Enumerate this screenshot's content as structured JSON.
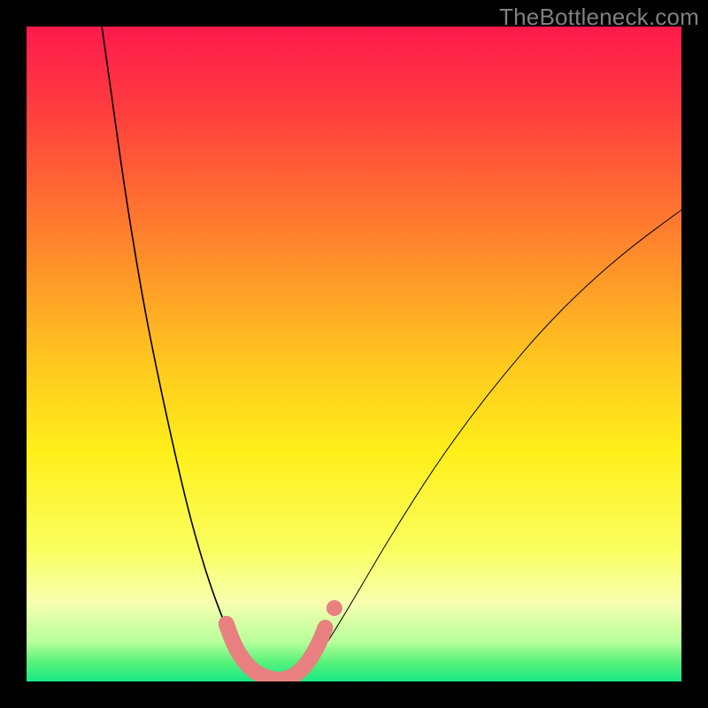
{
  "watermark": "TheBottleneck.com",
  "chart_data": {
    "type": "line",
    "title": "",
    "xlabel": "",
    "ylabel": "",
    "xlim": [
      0,
      100
    ],
    "ylim": [
      0,
      100
    ],
    "background_gradient_stops": [
      {
        "offset": 0.0,
        "color": "#ff1a4d"
      },
      {
        "offset": 0.12,
        "color": "#ff3b3f"
      },
      {
        "offset": 0.3,
        "color": "#ff7a2f"
      },
      {
        "offset": 0.5,
        "color": "#ffc31f"
      },
      {
        "offset": 0.65,
        "color": "#ffef1a"
      },
      {
        "offset": 0.8,
        "color": "#faff60"
      },
      {
        "offset": 0.88,
        "color": "#f7ffb0"
      },
      {
        "offset": 0.94,
        "color": "#b6ff9a"
      },
      {
        "offset": 0.97,
        "color": "#58f27a"
      },
      {
        "offset": 1.0,
        "color": "#19e884"
      }
    ],
    "series": [
      {
        "name": "left-curve",
        "type": "path",
        "stroke": "#000000",
        "stroke_width": 1.6,
        "points": [
          {
            "x": 11.5,
            "y": 100
          },
          {
            "x": 12.2,
            "y": 95
          },
          {
            "x": 13.2,
            "y": 88
          },
          {
            "x": 14.3,
            "y": 80
          },
          {
            "x": 15.5,
            "y": 72
          },
          {
            "x": 16.8,
            "y": 64
          },
          {
            "x": 18.2,
            "y": 56
          },
          {
            "x": 19.8,
            "y": 48
          },
          {
            "x": 21.5,
            "y": 40
          },
          {
            "x": 23.3,
            "y": 32
          },
          {
            "x": 25.0,
            "y": 25
          },
          {
            "x": 26.7,
            "y": 19
          },
          {
            "x": 28.3,
            "y": 14
          },
          {
            "x": 29.8,
            "y": 10
          },
          {
            "x": 31.0,
            "y": 7
          },
          {
            "x": 32.2,
            "y": 4.5
          },
          {
            "x": 33.5,
            "y": 2.5
          },
          {
            "x": 35.0,
            "y": 1.0
          },
          {
            "x": 36.5,
            "y": 0.3
          },
          {
            "x": 38.0,
            "y": 0.0
          }
        ]
      },
      {
        "name": "right-curve",
        "type": "path",
        "stroke": "#000000",
        "stroke_width": 1.0,
        "points": [
          {
            "x": 40.0,
            "y": 0.0
          },
          {
            "x": 41.5,
            "y": 0.6
          },
          {
            "x": 43.0,
            "y": 2.0
          },
          {
            "x": 45.0,
            "y": 4.5
          },
          {
            "x": 47.5,
            "y": 8.5
          },
          {
            "x": 50.5,
            "y": 13.5
          },
          {
            "x": 54.0,
            "y": 19.5
          },
          {
            "x": 58.0,
            "y": 26.0
          },
          {
            "x": 62.5,
            "y": 33.0
          },
          {
            "x": 67.5,
            "y": 40.0
          },
          {
            "x": 73.0,
            "y": 47.0
          },
          {
            "x": 79.0,
            "y": 54.0
          },
          {
            "x": 85.5,
            "y": 60.5
          },
          {
            "x": 92.5,
            "y": 66.5
          },
          {
            "x": 100.0,
            "y": 72.0
          }
        ]
      },
      {
        "name": "bottom-worm",
        "type": "worm",
        "stroke": "#e88080",
        "stroke_width": 18,
        "points": [
          {
            "x": 30.5,
            "y": 8.8
          },
          {
            "x": 31.2,
            "y": 6.8
          },
          {
            "x": 32.0,
            "y": 5.0
          },
          {
            "x": 33.0,
            "y": 3.4
          },
          {
            "x": 34.2,
            "y": 2.0
          },
          {
            "x": 35.6,
            "y": 1.0
          },
          {
            "x": 37.2,
            "y": 0.4
          },
          {
            "x": 38.8,
            "y": 0.2
          },
          {
            "x": 40.4,
            "y": 0.6
          },
          {
            "x": 41.8,
            "y": 1.6
          },
          {
            "x": 43.0,
            "y": 3.0
          },
          {
            "x": 44.0,
            "y": 4.6
          },
          {
            "x": 44.9,
            "y": 6.4
          },
          {
            "x": 45.6,
            "y": 8.2
          }
        ]
      },
      {
        "name": "detached-dot",
        "type": "dot",
        "fill": "#e88080",
        "cx": 47.0,
        "cy": 11.2,
        "r": 9
      }
    ]
  }
}
